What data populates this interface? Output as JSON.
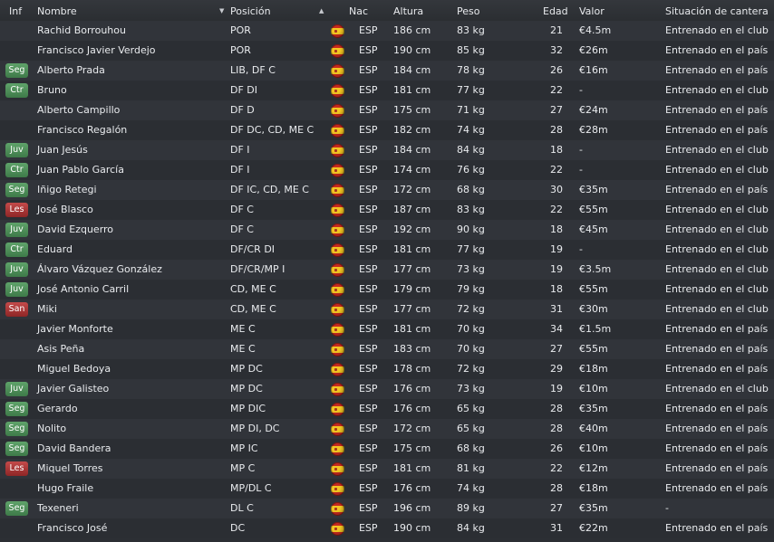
{
  "header": {
    "inf": "Inf",
    "nombre": "Nombre",
    "posicion": "Posición",
    "nac": "Nac",
    "altura": "Altura",
    "peso": "Peso",
    "edad": "Edad",
    "valor": "Valor",
    "situacion": "Situación de cantera"
  },
  "colors": {
    "badge_green": "#4f9159",
    "badge_red": "#a83535",
    "flag_red": "#c62a1f",
    "flag_yellow": "#f3c623"
  },
  "icons": {
    "sort_descending": "sort-descending-icon",
    "sort_ascending": "sort-ascending-icon",
    "nationality": "spain-flag-icon"
  },
  "rows": [
    {
      "inf": "",
      "badge": "",
      "nombre": "Rachid Borrouhou",
      "posicion": "POR",
      "nac": "ESP",
      "altura": "186 cm",
      "peso": "83 kg",
      "edad": "21",
      "valor": "€4.5m",
      "situacion": "Entrenado en el club"
    },
    {
      "inf": "",
      "badge": "",
      "nombre": "Francisco Javier Verdejo",
      "posicion": "POR",
      "nac": "ESP",
      "altura": "190 cm",
      "peso": "85 kg",
      "edad": "32",
      "valor": "€26m",
      "situacion": "Entrenado en el país"
    },
    {
      "inf": "Seg",
      "badge": "green",
      "nombre": "Alberto Prada",
      "posicion": "LIB, DF C",
      "nac": "ESP",
      "altura": "184 cm",
      "peso": "78 kg",
      "edad": "26",
      "valor": "€16m",
      "situacion": "Entrenado en el país"
    },
    {
      "inf": "Ctr",
      "badge": "green",
      "nombre": "Bruno",
      "posicion": "DF DI",
      "nac": "ESP",
      "altura": "181 cm",
      "peso": "77 kg",
      "edad": "22",
      "valor": "-",
      "situacion": "Entrenado en el club"
    },
    {
      "inf": "",
      "badge": "",
      "nombre": "Alberto Campillo",
      "posicion": "DF D",
      "nac": "ESP",
      "altura": "175 cm",
      "peso": "71 kg",
      "edad": "27",
      "valor": "€24m",
      "situacion": "Entrenado en el país"
    },
    {
      "inf": "",
      "badge": "",
      "nombre": "Francisco Regalón",
      "posicion": "DF DC, CD, ME C",
      "nac": "ESP",
      "altura": "182 cm",
      "peso": "74 kg",
      "edad": "28",
      "valor": "€28m",
      "situacion": "Entrenado en el país"
    },
    {
      "inf": "Juv",
      "badge": "green",
      "nombre": "Juan Jesús",
      "posicion": "DF I",
      "nac": "ESP",
      "altura": "184 cm",
      "peso": "84 kg",
      "edad": "18",
      "valor": "-",
      "situacion": "Entrenado en el club"
    },
    {
      "inf": "Ctr",
      "badge": "green",
      "nombre": "Juan Pablo García",
      "posicion": "DF I",
      "nac": "ESP",
      "altura": "174 cm",
      "peso": "76 kg",
      "edad": "22",
      "valor": "-",
      "situacion": "Entrenado en el club"
    },
    {
      "inf": "Seg",
      "badge": "green",
      "nombre": "Iñigo Retegi",
      "posicion": "DF IC, CD, ME C",
      "nac": "ESP",
      "altura": "172 cm",
      "peso": "68 kg",
      "edad": "30",
      "valor": "€35m",
      "situacion": "Entrenado en el país"
    },
    {
      "inf": "Les",
      "badge": "red",
      "nombre": "José Blasco",
      "posicion": "DF C",
      "nac": "ESP",
      "altura": "187 cm",
      "peso": "83 kg",
      "edad": "22",
      "valor": "€55m",
      "situacion": "Entrenado en el club"
    },
    {
      "inf": "Juv",
      "badge": "green",
      "nombre": "David Ezquerro",
      "posicion": "DF C",
      "nac": "ESP",
      "altura": "192 cm",
      "peso": "90 kg",
      "edad": "18",
      "valor": "€45m",
      "situacion": "Entrenado en el club"
    },
    {
      "inf": "Ctr",
      "badge": "green",
      "nombre": "Eduard",
      "posicion": "DF/CR DI",
      "nac": "ESP",
      "altura": "181 cm",
      "peso": "77 kg",
      "edad": "19",
      "valor": "-",
      "situacion": "Entrenado en el club"
    },
    {
      "inf": "Juv",
      "badge": "green",
      "nombre": "Álvaro Vázquez González",
      "posicion": "DF/CR/MP I",
      "nac": "ESP",
      "altura": "177 cm",
      "peso": "73 kg",
      "edad": "19",
      "valor": "€3.5m",
      "situacion": "Entrenado en el club"
    },
    {
      "inf": "Juv",
      "badge": "green",
      "nombre": "José Antonio Carril",
      "posicion": "CD, ME C",
      "nac": "ESP",
      "altura": "179 cm",
      "peso": "79 kg",
      "edad": "18",
      "valor": "€55m",
      "situacion": "Entrenado en el club"
    },
    {
      "inf": "San",
      "badge": "red",
      "nombre": "Miki",
      "posicion": "CD, ME C",
      "nac": "ESP",
      "altura": "177 cm",
      "peso": "72 kg",
      "edad": "31",
      "valor": "€30m",
      "situacion": "Entrenado en el club"
    },
    {
      "inf": "",
      "badge": "",
      "nombre": "Javier Monforte",
      "posicion": "ME C",
      "nac": "ESP",
      "altura": "181 cm",
      "peso": "70 kg",
      "edad": "34",
      "valor": "€1.5m",
      "situacion": "Entrenado en el país"
    },
    {
      "inf": "",
      "badge": "",
      "nombre": "Asis Peña",
      "posicion": "ME C",
      "nac": "ESP",
      "altura": "183 cm",
      "peso": "70 kg",
      "edad": "27",
      "valor": "€55m",
      "situacion": "Entrenado en el país"
    },
    {
      "inf": "",
      "badge": "",
      "nombre": "Miguel Bedoya",
      "posicion": "MP DC",
      "nac": "ESP",
      "altura": "178 cm",
      "peso": "72 kg",
      "edad": "29",
      "valor": "€18m",
      "situacion": "Entrenado en el país"
    },
    {
      "inf": "Juv",
      "badge": "green",
      "nombre": "Javier Galisteo",
      "posicion": "MP DC",
      "nac": "ESP",
      "altura": "176 cm",
      "peso": "73 kg",
      "edad": "19",
      "valor": "€10m",
      "situacion": "Entrenado en el club"
    },
    {
      "inf": "Seg",
      "badge": "green",
      "nombre": "Gerardo",
      "posicion": "MP DIC",
      "nac": "ESP",
      "altura": "176 cm",
      "peso": "65 kg",
      "edad": "28",
      "valor": "€35m",
      "situacion": "Entrenado en el país"
    },
    {
      "inf": "Seg",
      "badge": "green",
      "nombre": "Nolito",
      "posicion": "MP DI, DC",
      "nac": "ESP",
      "altura": "172 cm",
      "peso": "65 kg",
      "edad": "28",
      "valor": "€40m",
      "situacion": "Entrenado en el país"
    },
    {
      "inf": "Seg",
      "badge": "green",
      "nombre": "David Bandera",
      "posicion": "MP IC",
      "nac": "ESP",
      "altura": "175 cm",
      "peso": "68 kg",
      "edad": "26",
      "valor": "€10m",
      "situacion": "Entrenado en el país"
    },
    {
      "inf": "Les",
      "badge": "red",
      "nombre": "Miquel Torres",
      "posicion": "MP C",
      "nac": "ESP",
      "altura": "181 cm",
      "peso": "81 kg",
      "edad": "22",
      "valor": "€12m",
      "situacion": "Entrenado en el país"
    },
    {
      "inf": "",
      "badge": "",
      "nombre": "Hugo Fraile",
      "posicion": "MP/DL C",
      "nac": "ESP",
      "altura": "176 cm",
      "peso": "74 kg",
      "edad": "28",
      "valor": "€18m",
      "situacion": "Entrenado en el país"
    },
    {
      "inf": "Seg",
      "badge": "green",
      "nombre": "Texeneri",
      "posicion": "DL C",
      "nac": "ESP",
      "altura": "196 cm",
      "peso": "89 kg",
      "edad": "27",
      "valor": "€35m",
      "situacion": "-"
    },
    {
      "inf": "",
      "badge": "",
      "nombre": "Francisco José",
      "posicion": "DC",
      "nac": "ESP",
      "altura": "190 cm",
      "peso": "84 kg",
      "edad": "31",
      "valor": "€22m",
      "situacion": "Entrenado en el país"
    }
  ]
}
